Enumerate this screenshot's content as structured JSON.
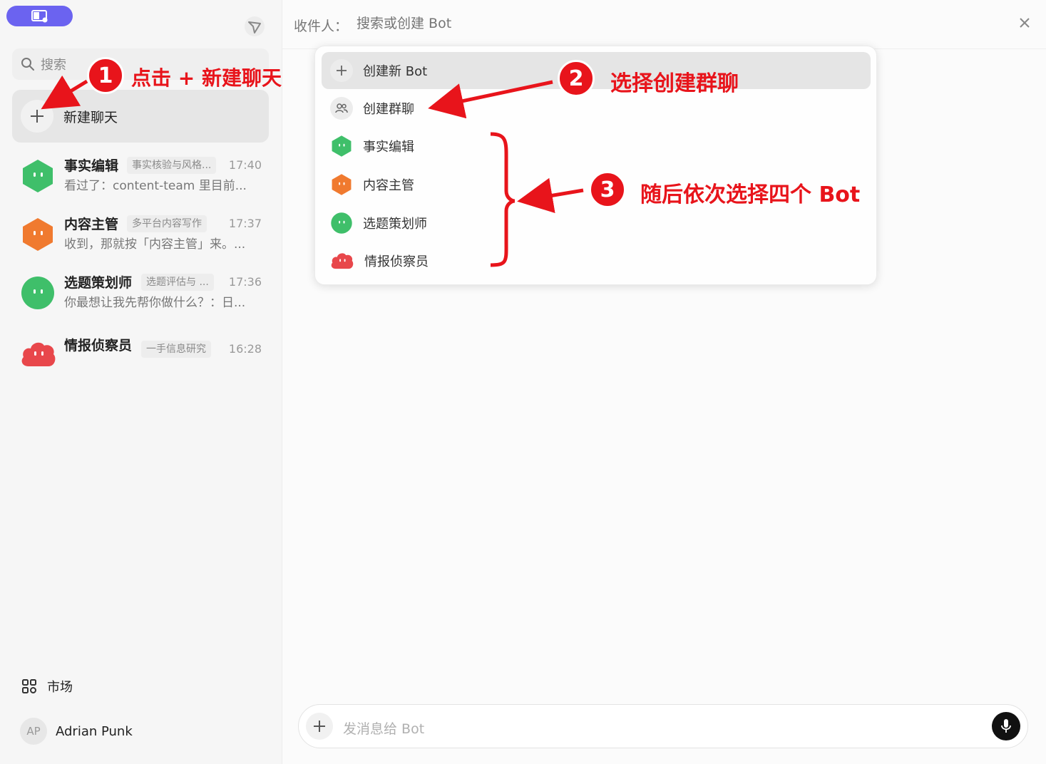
{
  "sidebar": {
    "search_placeholder": "搜索",
    "new_chat_label": "新建聊天",
    "chats": [
      {
        "name": "事实编辑",
        "tag": "事实核验与风格...",
        "time": "17:40",
        "preview": "看过了：content-team 里目前...",
        "color": "#3fbf6a"
      },
      {
        "name": "内容主管",
        "tag": "多平台内容写作",
        "time": "17:37",
        "preview": "收到，那就按「内容主管」来。...",
        "color": "#f07a2f"
      },
      {
        "name": "选题策划师",
        "tag": "选题评估与 ...",
        "time": "17:36",
        "preview": "你最想让我先帮你做什么？：日...",
        "color": "#3fbf6a"
      },
      {
        "name": "情报侦察员",
        "tag": "一手信息研究",
        "time": "16:28",
        "preview": "",
        "color": "#e8474b"
      }
    ],
    "market_label": "市场",
    "user_initials": "AP",
    "user_name": "Adrian Punk"
  },
  "header": {
    "recipient_label": "收件人：",
    "recipient_placeholder": "搜索或创建 Bot"
  },
  "dropdown": {
    "items": [
      {
        "label": "创建新 Bot",
        "icon": "plus-icon"
      },
      {
        "label": "创建群聊",
        "icon": "group-icon"
      },
      {
        "label": "事实编辑",
        "icon": "bot-avatar-green-hex",
        "color": "#3fbf6a"
      },
      {
        "label": "内容主管",
        "icon": "bot-avatar-orange-hex",
        "color": "#f07a2f"
      },
      {
        "label": "选题策划师",
        "icon": "bot-avatar-green-round",
        "color": "#3fbf6a"
      },
      {
        "label": "情报侦察员",
        "icon": "bot-avatar-red-cloud",
        "color": "#e8474b"
      }
    ]
  },
  "composer": {
    "placeholder": "发消息给 Bot"
  },
  "annotations": {
    "step1_number": "1",
    "step1_text": "点击 + 新建聊天",
    "step2_number": "2",
    "step2_text": "选择创建群聊",
    "step3_number": "3",
    "step3_text": "随后依次选择四个 Bot",
    "color": "#e8141b"
  },
  "colors": {
    "accent": "#6b63f0",
    "annotation": "#e8141b"
  }
}
